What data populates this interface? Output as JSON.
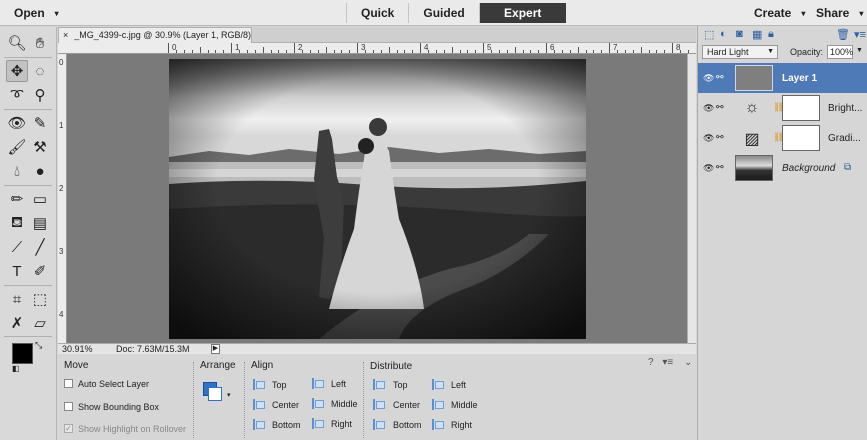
{
  "topbar": {
    "open_label": "Open",
    "modes": [
      "Quick",
      "Guided",
      "Expert"
    ],
    "active_mode": "Expert",
    "create_label": "Create",
    "share_label": "Share"
  },
  "document": {
    "tab_title": "_MG_4399-c.jpg @ 30.9% (Layer 1, RGB/8) *",
    "close_icon": "×",
    "ruler_top": [
      "0",
      "1",
      "2",
      "3",
      "4",
      "5",
      "6",
      "7",
      "8"
    ],
    "ruler_left": [
      "0",
      "1",
      "2",
      "3",
      "4"
    ],
    "zoom": "30.91%",
    "doc_size": "Doc: 7.63M/15.3M"
  },
  "tool_options": {
    "move_title": "Move",
    "auto_select": "Auto Select Layer",
    "show_bounding": "Show Bounding Box",
    "show_highlight": "Show Highlight on Rollover",
    "arrange_title": "Arrange",
    "align_title": "Align",
    "align": {
      "top": "Top",
      "center": "Center",
      "bottom": "Bottom",
      "left": "Left",
      "middle": "Middle",
      "right": "Right"
    },
    "distribute_title": "Distribute",
    "distribute": {
      "top": "Top",
      "center": "Center",
      "bottom": "Bottom",
      "left": "Left",
      "middle": "Middle",
      "right": "Right"
    }
  },
  "layers_panel": {
    "blend_mode": "Hard Light",
    "opacity_label": "Opacity:",
    "opacity_value": "100%",
    "layers": [
      {
        "name": "Layer 1",
        "active": true
      },
      {
        "name": "Bright...",
        "active": false
      },
      {
        "name": "Gradi...",
        "active": false
      },
      {
        "name": "Background",
        "active": false
      }
    ]
  },
  "colors": {
    "active_tab": "#3a3a3a",
    "selected_layer": "#4f7ab8",
    "canvas_bg": "#7a7a7a"
  }
}
